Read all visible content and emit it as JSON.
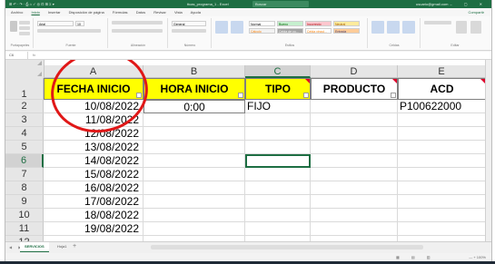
{
  "titlebar": {
    "quick_access": "⊞ ↶ · ↷ · ⎙ ⌂ ✓ ◎ ⊡ ⊞ Σ ▾",
    "file_name": "ttcas_programa_1 - Excel",
    "search_placeholder": "Buscar",
    "user": "usuario@gmail.com",
    "window_controls": "– ▢ ✕"
  },
  "menu": {
    "items": [
      "Archivo",
      "Inicio",
      "Insertar",
      "Disposición de página",
      "Fórmulas",
      "Datos",
      "Revisar",
      "Vista",
      "Ayuda"
    ],
    "share": "Compartir"
  },
  "ribbon": {
    "groups": [
      "Portapapeles",
      "Fuente",
      "Alineación",
      "Número",
      "Estilos",
      "Celdas",
      "Editar"
    ],
    "font_name": "Arial",
    "font_size": "10",
    "number_format": "General",
    "styles": [
      {
        "label": "Normal",
        "bg": "#ffffff",
        "fg": "#000000"
      },
      {
        "label": "Bueno",
        "bg": "#c6efce",
        "fg": "#006100"
      },
      {
        "label": "Incorrecto",
        "bg": "#ffc7ce",
        "fg": "#9c0006"
      },
      {
        "label": "Neutral",
        "bg": "#ffeb9c",
        "fg": "#9c5700"
      },
      {
        "label": "Cálculo",
        "bg": "#f2f2f2",
        "fg": "#fa7d00"
      },
      {
        "label": "Celda de co...",
        "bg": "#a5a5a5",
        "fg": "#ffffff"
      },
      {
        "label": "Celda vincul...",
        "bg": "#ffffff",
        "fg": "#fa7d00"
      },
      {
        "label": "Entrada",
        "bg": "#ffcc99",
        "fg": "#3f3f76"
      }
    ]
  },
  "formula_bar": {
    "name_box": "C6",
    "fx": "fx"
  },
  "columns": [
    "A",
    "B",
    "C",
    "D",
    "E"
  ],
  "rows": [
    "1",
    "2",
    "3",
    "4",
    "5",
    "6",
    "7",
    "8",
    "9",
    "10",
    "11",
    "12"
  ],
  "headers": {
    "fecha_inicio": "FECHA INICIO",
    "hora_inicio": "HORA INICIO",
    "tipo": "TIPO",
    "producto": "PRODUCTO",
    "acd": "ACD"
  },
  "dates": [
    "10/08/2022",
    "11/08/2022",
    "12/08/2022",
    "13/08/2022",
    "14/08/2022",
    "15/08/2022",
    "16/08/2022",
    "17/08/2022",
    "18/08/2022",
    "19/08/2022"
  ],
  "row2": {
    "hora": "0:00",
    "tipo": "FIJO",
    "acd": "P100622000"
  },
  "sheets": [
    "SERVICIOS",
    "Hoja1"
  ],
  "add_sheet": "+",
  "status": {
    "views": "▦ ▤ ▥",
    "zoom": "— + 100%"
  }
}
